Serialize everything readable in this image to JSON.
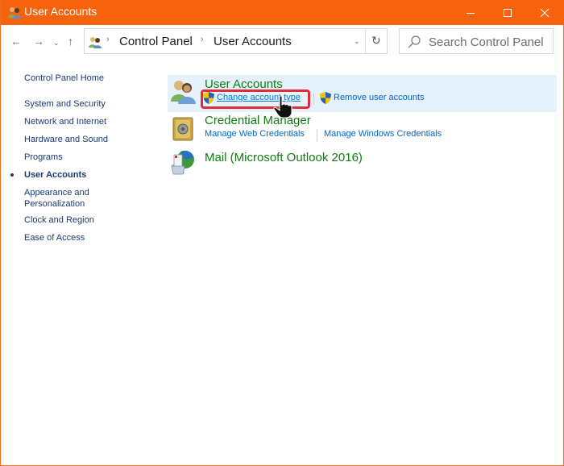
{
  "window": {
    "title": "User Accounts",
    "icon": "user-accounts-icon",
    "controls": {
      "minimize": "minimize-icon",
      "maximize": "maximize-icon",
      "close": "close-icon"
    },
    "accent_color": "#f7630c"
  },
  "navigation": {
    "back": "←",
    "forward": "→",
    "recent": "⌄",
    "up": "↑",
    "breadcrumb": [
      "Control Panel",
      "User Accounts"
    ],
    "breadcrumb_separator": "›",
    "dropdown": "⌄",
    "refresh": "↻"
  },
  "search": {
    "placeholder": "Search Control Panel",
    "value": ""
  },
  "sidebar": {
    "home": "Control Panel Home",
    "items": [
      {
        "label": "System and Security",
        "current": false
      },
      {
        "label": "Network and Internet",
        "current": false
      },
      {
        "label": "Hardware and Sound",
        "current": false
      },
      {
        "label": "Programs",
        "current": false
      },
      {
        "label": "User Accounts",
        "current": true
      },
      {
        "label": "Appearance and",
        "label2": "Personalization",
        "current": false
      },
      {
        "label": "Clock and Region",
        "current": false
      },
      {
        "label": "Ease of Access",
        "current": false
      }
    ]
  },
  "categories": [
    {
      "title": "User Accounts",
      "icon": "user-accounts-icon",
      "links": [
        {
          "label": "Change account type",
          "shield": true,
          "highlighted": true
        },
        {
          "label": "Remove user accounts",
          "shield": true
        }
      ]
    },
    {
      "title": "Credential Manager",
      "icon": "credential-safe-icon",
      "links": [
        {
          "label": "Manage Web Credentials"
        },
        {
          "label": "Manage Windows Credentials"
        }
      ]
    },
    {
      "title": "Mail (Microsoft Outlook 2016)",
      "icon": "mail-icon",
      "links": []
    }
  ],
  "colors": {
    "category_title": "#107c10",
    "link": "#0066cc",
    "highlight_row": "#e5f1fb",
    "annotation_box": "#e02d3c"
  }
}
